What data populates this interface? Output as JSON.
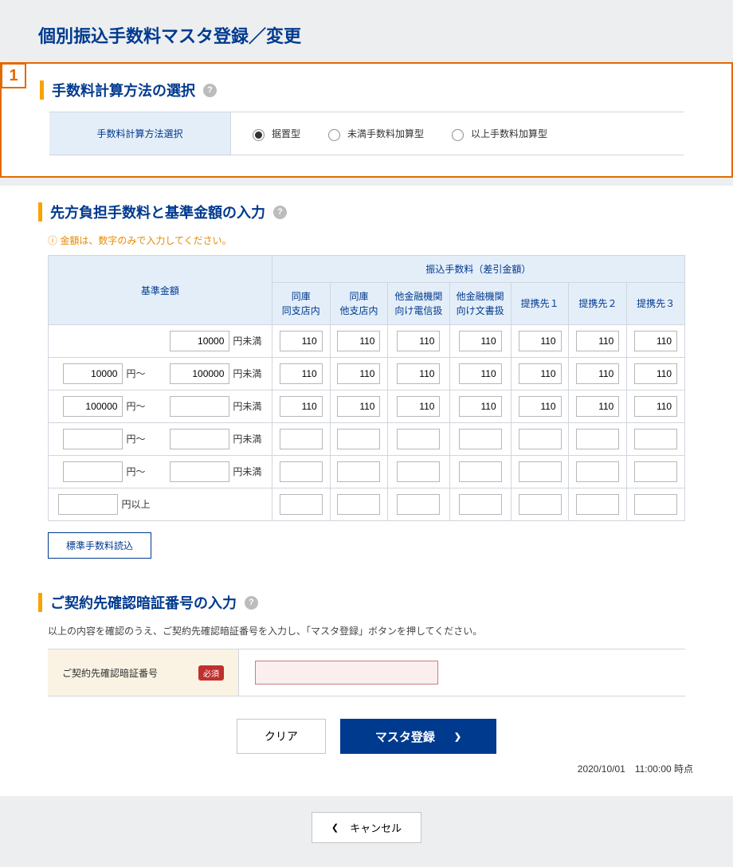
{
  "page_title": "個別振込手数料マスタ登録／変更",
  "step_badge": "1",
  "section1": {
    "heading": "手数料計算方法の選択",
    "row_label": "手数料計算方法選択",
    "options": [
      "据置型",
      "未満手数料加算型",
      "以上手数料加算型"
    ],
    "selected": 0
  },
  "section2": {
    "heading": "先方負担手数料と基準金額の入力",
    "note": "金額は、数字のみで入力してください。",
    "base_header": "基準金額",
    "fee_group_header": "振込手数料（差引金額）",
    "columns": [
      "同庫\n同支店内",
      "同庫\n他支店内",
      "他金融機関\n向け電信扱",
      "他金融機関\n向け文書扱",
      "提携先１",
      "提携先２",
      "提携先３"
    ],
    "suffix_from": "円～",
    "suffix_less": "円未満",
    "suffix_up": "円以上",
    "rows": [
      {
        "from": "",
        "to": "10000",
        "fees": [
          "110",
          "110",
          "110",
          "110",
          "110",
          "110",
          "110"
        ]
      },
      {
        "from": "10000",
        "to": "100000",
        "fees": [
          "110",
          "110",
          "110",
          "110",
          "110",
          "110",
          "110"
        ]
      },
      {
        "from": "100000",
        "to": "",
        "fees": [
          "110",
          "110",
          "110",
          "110",
          "110",
          "110",
          "110"
        ]
      },
      {
        "from": "",
        "to": "",
        "fees": [
          "",
          "",
          "",
          "",
          "",
          "",
          ""
        ]
      },
      {
        "from": "",
        "to": "",
        "fees": [
          "",
          "",
          "",
          "",
          "",
          "",
          ""
        ]
      },
      {
        "from": "",
        "to": null,
        "fees": [
          "",
          "",
          "",
          "",
          "",
          "",
          ""
        ]
      }
    ],
    "load_button": "標準手数料読込"
  },
  "section3": {
    "heading": "ご契約先確認暗証番号の入力",
    "desc": "以上の内容を確認のうえ、ご契約先確認暗証番号を入力し、「マスタ登録」ボタンを押してください。",
    "row_label": "ご契約先確認暗証番号",
    "required_badge": "必須"
  },
  "actions": {
    "clear": "クリア",
    "submit": "マスタ登録"
  },
  "timestamp": "2020/10/01　11:00:00 時点",
  "cancel": "キャンセル"
}
